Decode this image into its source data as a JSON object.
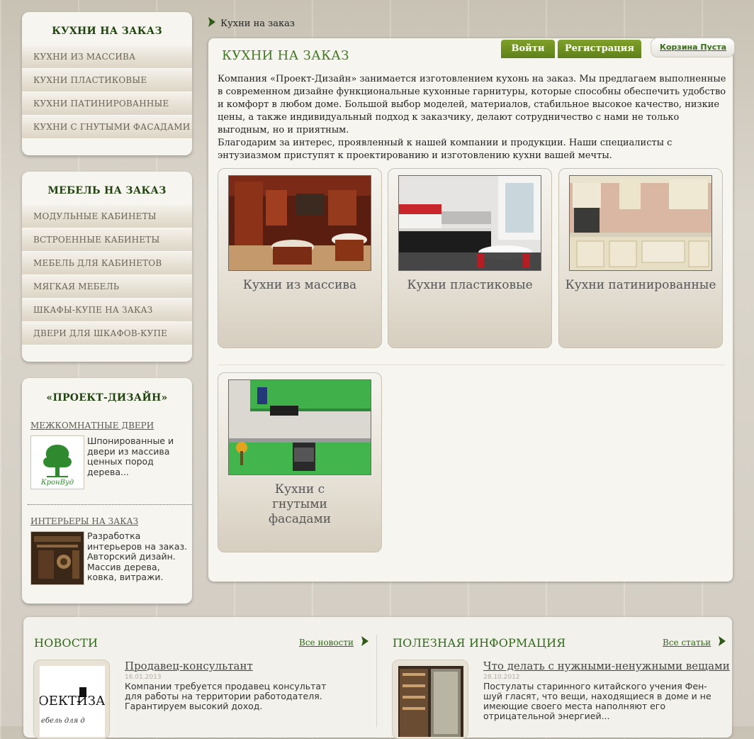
{
  "breadcrumb": {
    "current": "Кухни на заказ"
  },
  "sidebar": {
    "kitchens": {
      "title": "КУХНИ НА ЗАКАЗ",
      "items": [
        {
          "label": "КУХНИ ИЗ МАССИВА"
        },
        {
          "label": "КУХНИ ПЛАСТИКОВЫЕ"
        },
        {
          "label": "КУХНИ ПАТИНИРОВАННЫЕ"
        },
        {
          "label": "КУХНИ С ГНУТЫМИ ФАСАДАМИ"
        }
      ]
    },
    "furniture": {
      "title": "МЕБЕЛЬ НА ЗАКАЗ",
      "items": [
        {
          "label": "МОДУЛЬНЫЕ КАБИНЕТЫ"
        },
        {
          "label": "ВСТРОЕННЫЕ КАБИНЕТЫ"
        },
        {
          "label": "МЕБЕЛЬ ДЛЯ КАБИНЕТОВ"
        },
        {
          "label": "МЯГКАЯ МЕБЕЛЬ"
        },
        {
          "label": "ШКАФЫ-КУПЕ НА ЗАКАЗ"
        },
        {
          "label": "ДВЕРИ ДЛЯ ШКАФОВ-КУПЕ"
        }
      ]
    },
    "promo": {
      "title": "«ПРОЕКТ-ДИЗАЙН»",
      "items": [
        {
          "link": "МЕЖКОМНАТНЫЕ ДВЕРИ",
          "text": "Шпонированные и двери из массива ценных пород дерева...",
          "logo_text": "КронВуд"
        },
        {
          "link": "ИНТЕРЬЕРЫ НА ЗАКАЗ",
          "text": "Разработка интерьеров на заказ. Авторский дизайн. Массив дерева, ковка, витражи."
        }
      ]
    }
  },
  "header": {
    "login_label": "Войти",
    "register_label": "Регистрация",
    "cart_label": "Корзина Пуста"
  },
  "main": {
    "title": "КУХНИ НА ЗАКАЗ",
    "intro": "Компания «Проект-Дизайн» занимается изготовлением кухонь на заказ. Мы предлагаем выполненные в современном дизайне функциональные кухонные гарнитуры, которые способны обеспечить удобство и комфорт в любом доме. Большой выбор моделей, материалов, стабильное высокое качество, низкие цены, а также индивидуальный подход к заказчику, делают сотрудничество с нами не только выгодным, но и приятным.",
    "intro2": "Благодарим за интерес, проявленный к нашей компании и продукции. Наши специалисты с энтузиазмом приступят к проектированию и изготовлению кухни вашей мечты.",
    "cards": [
      {
        "caption": "Кухни из массива"
      },
      {
        "caption": "Кухни пластиковые"
      },
      {
        "caption": "Кухни патинированные"
      },
      {
        "caption": "Кухни с гнутыми фасадами"
      }
    ]
  },
  "news": {
    "title": "НОВОСТИ",
    "all_label": "Все новости",
    "item": {
      "title": "Продавец-консультант",
      "date": "16.01.2013",
      "text": "Компании требуется продавец консультат для работы на территории работодателя. Гарантируем высокий доход.",
      "logo_line1": "ОЕКТ-",
      "logo_line2": "ИЗА",
      "logo_line3": "ебель для д"
    }
  },
  "useful": {
    "title": "ПОЛЕЗНАЯ ИНФОРМАЦИЯ",
    "all_label": "Все статьи",
    "item": {
      "title": "Что делать с нужными-ненужными вещами",
      "date": "28.10.2012",
      "text": "Постулаты старинного китайского учения Фен-шуй гласят, что вещи, находящиеся в доме и не имеющие своего места наполняют его отрицательной энергией..."
    }
  }
}
